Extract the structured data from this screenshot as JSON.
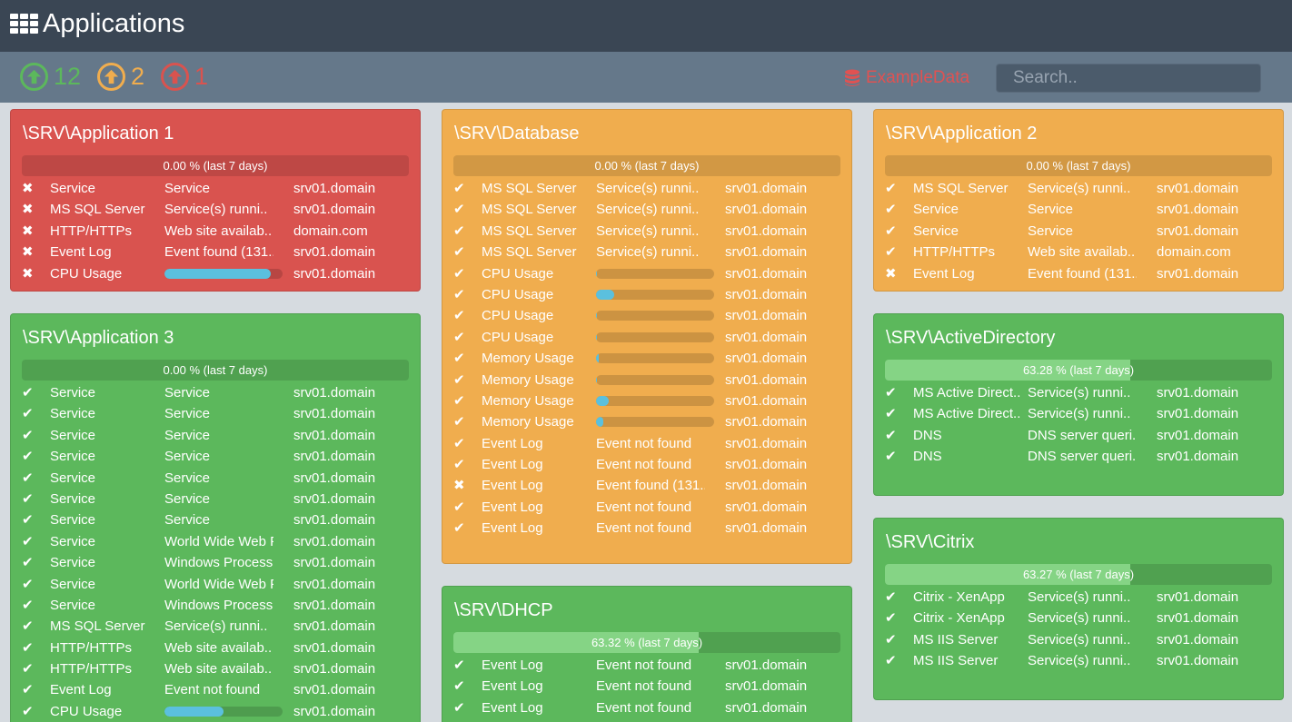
{
  "header": {
    "title": "Applications",
    "icon": "grid-icon"
  },
  "summary": {
    "ok_count": "12",
    "warning_count": "2",
    "error_count": "1",
    "dataset_label": "ExampleData",
    "search_placeholder": "Search.."
  },
  "colors": {
    "ok": "#5cb85c",
    "warning": "#f0ad4e",
    "error": "#d9534f",
    "progress": "#5bc0de"
  },
  "panels": [
    {
      "title": "\\SRV\\Application 1",
      "state": "red",
      "uptime_label": "0.00 % (last 7 days)",
      "uptime_fraction": 0.0,
      "rows": [
        {
          "ok": false,
          "name": "Service",
          "status": "Service",
          "host": "srv01.domain"
        },
        {
          "ok": false,
          "name": "MS SQL Server",
          "status": "Service(s) runni..",
          "host": "srv01.domain"
        },
        {
          "ok": false,
          "name": "HTTP/HTTPs",
          "status": "Web site availab..",
          "host": "domain.com"
        },
        {
          "ok": false,
          "name": "Event Log",
          "status": "Event found (131..",
          "host": "srv01.domain"
        },
        {
          "ok": false,
          "name": "CPU Usage",
          "progress": 0.9,
          "host": "srv01.domain"
        }
      ]
    },
    {
      "title": "\\SRV\\Database",
      "state": "orange",
      "uptime_label": "0.00 % (last 7 days)",
      "uptime_fraction": 0.0,
      "rows": [
        {
          "ok": true,
          "name": "MS SQL Server",
          "status": "Service(s) runni..",
          "host": "srv01.domain"
        },
        {
          "ok": true,
          "name": "MS SQL Server",
          "status": "Service(s) runni..",
          "host": "srv01.domain"
        },
        {
          "ok": true,
          "name": "MS SQL Server",
          "status": "Service(s) runni..",
          "host": "srv01.domain"
        },
        {
          "ok": true,
          "name": "MS SQL Server",
          "status": "Service(s) runni..",
          "host": "srv01.domain"
        },
        {
          "ok": true,
          "name": "CPU Usage",
          "progress": 0.01,
          "host": "srv01.domain"
        },
        {
          "ok": true,
          "name": "CPU Usage",
          "progress": 0.15,
          "host": "srv01.domain"
        },
        {
          "ok": true,
          "name": "CPU Usage",
          "progress": 0.01,
          "host": "srv01.domain"
        },
        {
          "ok": true,
          "name": "CPU Usage",
          "progress": 0.01,
          "host": "srv01.domain"
        },
        {
          "ok": true,
          "name": "Memory Usage",
          "progress": 0.02,
          "host": "srv01.domain"
        },
        {
          "ok": true,
          "name": "Memory Usage",
          "progress": 0.01,
          "host": "srv01.domain"
        },
        {
          "ok": true,
          "name": "Memory Usage",
          "progress": 0.11,
          "host": "srv01.domain"
        },
        {
          "ok": true,
          "name": "Memory Usage",
          "progress": 0.06,
          "host": "srv01.domain"
        },
        {
          "ok": true,
          "name": "Event Log",
          "status": "Event not found",
          "host": "srv01.domain"
        },
        {
          "ok": true,
          "name": "Event Log",
          "status": "Event not found",
          "host": "srv01.domain"
        },
        {
          "ok": false,
          "name": "Event Log",
          "status": "Event found (131..",
          "host": "srv01.domain"
        },
        {
          "ok": true,
          "name": "Event Log",
          "status": "Event not found",
          "host": "srv01.domain"
        },
        {
          "ok": true,
          "name": "Event Log",
          "status": "Event not found",
          "host": "srv01.domain"
        }
      ]
    },
    {
      "title": "\\SRV\\Application 2",
      "state": "orange",
      "uptime_label": "0.00 % (last 7 days)",
      "uptime_fraction": 0.0,
      "rows": [
        {
          "ok": true,
          "name": "MS SQL Server",
          "status": "Service(s) runni..",
          "host": "srv01.domain"
        },
        {
          "ok": true,
          "name": "Service",
          "status": "Service",
          "host": "srv01.domain"
        },
        {
          "ok": true,
          "name": "Service",
          "status": "Service",
          "host": "srv01.domain"
        },
        {
          "ok": true,
          "name": "HTTP/HTTPs",
          "status": "Web site availab..",
          "host": "domain.com"
        },
        {
          "ok": false,
          "name": "Event Log",
          "status": "Event found (131..",
          "host": "srv01.domain"
        }
      ]
    },
    {
      "title": "\\SRV\\Application 3",
      "state": "green",
      "uptime_label": "0.00 % (last 7 days)",
      "uptime_fraction": 0.0,
      "rows": [
        {
          "ok": true,
          "name": "Service",
          "status": "Service",
          "host": "srv01.domain"
        },
        {
          "ok": true,
          "name": "Service",
          "status": "Service",
          "host": "srv01.domain"
        },
        {
          "ok": true,
          "name": "Service",
          "status": "Service",
          "host": "srv01.domain"
        },
        {
          "ok": true,
          "name": "Service",
          "status": "Service",
          "host": "srv01.domain"
        },
        {
          "ok": true,
          "name": "Service",
          "status": "Service",
          "host": "srv01.domain"
        },
        {
          "ok": true,
          "name": "Service",
          "status": "Service",
          "host": "srv01.domain"
        },
        {
          "ok": true,
          "name": "Service",
          "status": "Service",
          "host": "srv01.domain"
        },
        {
          "ok": true,
          "name": "Service",
          "status": "World Wide Web P..",
          "host": "srv01.domain"
        },
        {
          "ok": true,
          "name": "Service",
          "status": "Windows Process ..",
          "host": "srv01.domain"
        },
        {
          "ok": true,
          "name": "Service",
          "status": "World Wide Web P..",
          "host": "srv01.domain"
        },
        {
          "ok": true,
          "name": "Service",
          "status": "Windows Process ..",
          "host": "srv01.domain"
        },
        {
          "ok": true,
          "name": "MS SQL Server",
          "status": "Service(s) runni..",
          "host": "srv01.domain"
        },
        {
          "ok": true,
          "name": "HTTP/HTTPs",
          "status": "Web site availab..",
          "host": "srv01.domain"
        },
        {
          "ok": true,
          "name": "HTTP/HTTPs",
          "status": "Web site availab..",
          "host": "srv01.domain"
        },
        {
          "ok": true,
          "name": "Event Log",
          "status": "Event not found",
          "host": "srv01.domain"
        },
        {
          "ok": true,
          "name": "CPU Usage",
          "progress": 0.5,
          "host": "srv01.domain"
        }
      ]
    },
    {
      "title": "\\SRV\\ActiveDirectory",
      "state": "green",
      "uptime_label": "63.28 % (last 7 days)",
      "uptime_fraction": 0.6328,
      "rows": [
        {
          "ok": true,
          "name": "MS Active Direct..",
          "status": "Service(s) runni..",
          "host": "srv01.domain"
        },
        {
          "ok": true,
          "name": "MS Active Direct..",
          "status": "Service(s) runni..",
          "host": "srv01.domain"
        },
        {
          "ok": true,
          "name": "DNS",
          "status": "DNS server queri..",
          "host": "srv01.domain"
        },
        {
          "ok": true,
          "name": "DNS",
          "status": "DNS server queri..",
          "host": "srv01.domain"
        }
      ]
    },
    {
      "title": "\\SRV\\DHCP",
      "state": "green",
      "uptime_label": "63.32 % (last 7 days)",
      "uptime_fraction": 0.6332,
      "rows": [
        {
          "ok": true,
          "name": "Event Log",
          "status": "Event not found",
          "host": "srv01.domain"
        },
        {
          "ok": true,
          "name": "Event Log",
          "status": "Event not found",
          "host": "srv01.domain"
        },
        {
          "ok": true,
          "name": "Event Log",
          "status": "Event not found",
          "host": "srv01.domain"
        }
      ]
    },
    {
      "title": "\\SRV\\Citrix",
      "state": "green",
      "uptime_label": "63.27 % (last 7 days)",
      "uptime_fraction": 0.6327,
      "rows": [
        {
          "ok": true,
          "name": "Citrix - XenApp",
          "status": "Service(s) runni..",
          "host": "srv01.domain"
        },
        {
          "ok": true,
          "name": "Citrix - XenApp",
          "status": "Service(s) runni..",
          "host": "srv01.domain"
        },
        {
          "ok": true,
          "name": "MS IIS Server",
          "status": "Service(s) runni..",
          "host": "srv01.domain"
        },
        {
          "ok": true,
          "name": "MS IIS Server",
          "status": "Service(s) runni..",
          "host": "srv01.domain"
        }
      ]
    }
  ]
}
